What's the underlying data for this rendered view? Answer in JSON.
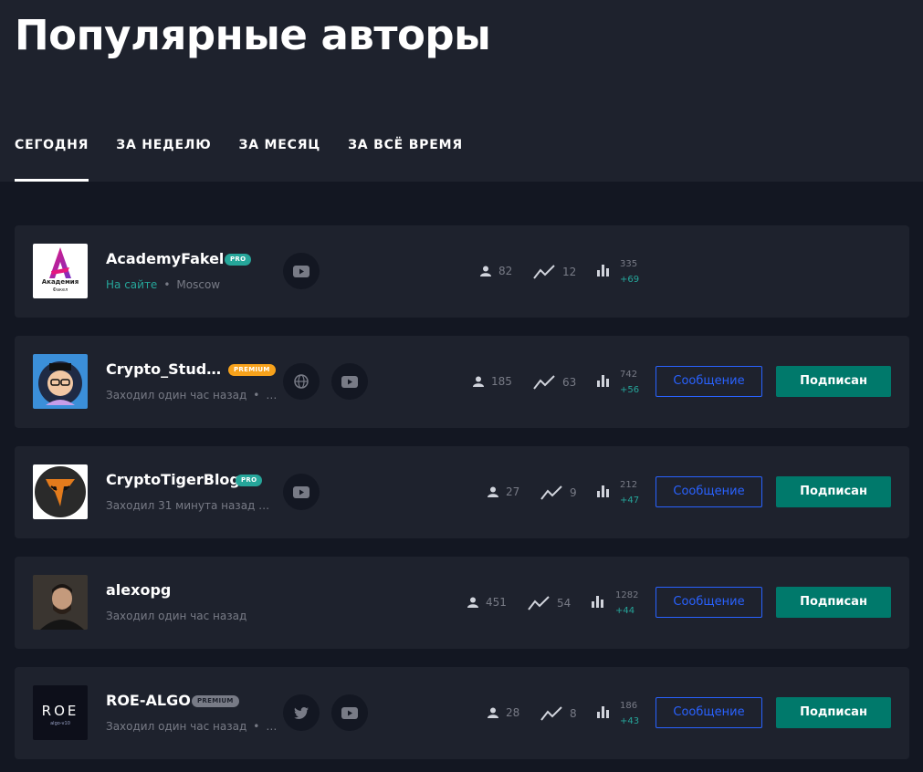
{
  "page_title": "Популярные авторы",
  "tabs": [
    {
      "label": "СЕГОДНЯ",
      "active": true
    },
    {
      "label": "ЗА НЕДЕЛЮ",
      "active": false
    },
    {
      "label": "ЗА МЕСЯЦ",
      "active": false
    },
    {
      "label": "ЗА ВСЁ ВРЕМЯ",
      "active": false
    }
  ],
  "buttons": {
    "message": "Сообщение",
    "subscribed": "Подписан"
  },
  "authors": [
    {
      "name": "AcademyFakel",
      "badge": "PRO",
      "status": "На сайте",
      "location": "Moscow",
      "social": [
        "youtube-icon"
      ],
      "followers": "82",
      "ideas": "12",
      "rank": "335",
      "rank_delta": "+69",
      "avatar_text": {
        "line1": "Академия",
        "line2": "Факел"
      }
    },
    {
      "name": "Crypto_Stud…",
      "badge": "PREMIUM",
      "status": "Заходил один час назад",
      "location": "…",
      "social": [
        "globe-icon",
        "youtube-icon"
      ],
      "followers": "185",
      "ideas": "63",
      "rank": "742",
      "rank_delta": "+56"
    },
    {
      "name": "CryptoTigerBlog",
      "badge": "PRO",
      "status": "Заходил 31 минута назад …",
      "social": [
        "youtube-icon"
      ],
      "followers": "27",
      "ideas": "9",
      "rank": "212",
      "rank_delta": "+47"
    },
    {
      "name": "alexopg",
      "status": "Заходил один час назад",
      "social": [],
      "followers": "451",
      "ideas": "54",
      "rank": "1282",
      "rank_delta": "+44"
    },
    {
      "name": "ROE-ALGO",
      "badge": "PREMIUM",
      "status": "Заходил один час назад",
      "location": "…",
      "social": [
        "twitter-icon",
        "youtube-icon"
      ],
      "followers": "28",
      "ideas": "8",
      "rank": "186",
      "rank_delta": "+43",
      "avatar_text": {
        "line1": "ROE",
        "line2": "algo-v10"
      }
    }
  ],
  "colors": {
    "background": "#131722",
    "panel": "#1e222d",
    "accent_green": "#26a69a",
    "button_teal": "#00796b",
    "button_blue": "#2962ff",
    "premium_orange": "#f7a21b"
  }
}
